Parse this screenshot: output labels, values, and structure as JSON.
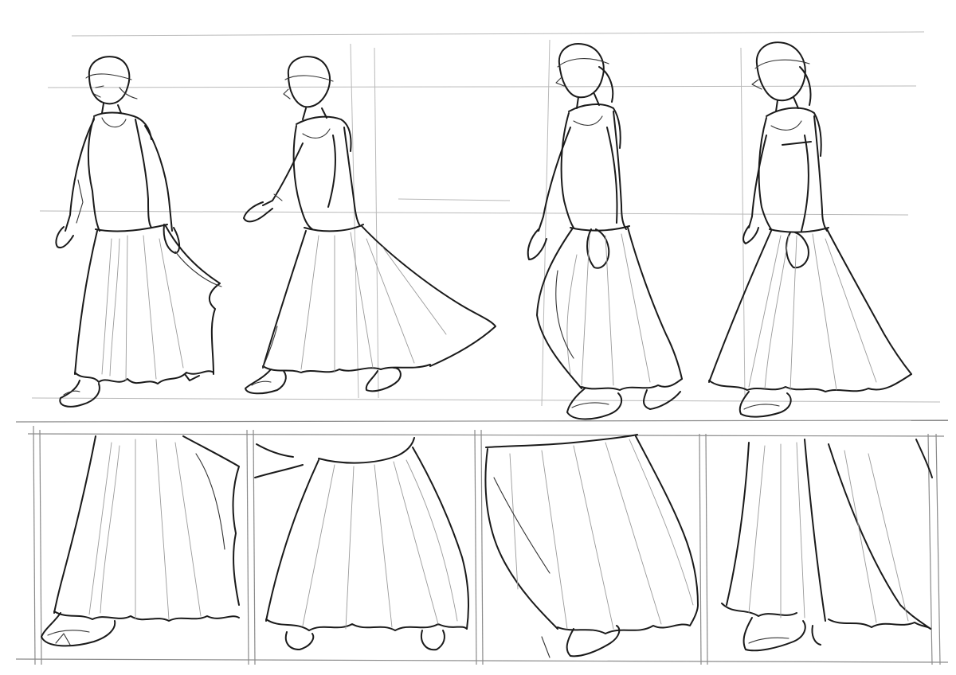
{
  "sheet": {
    "kind": "pencil-sketch-study",
    "palette": {
      "paper": "#ffffff",
      "ink": "#1a1a1a",
      "construction": "#b9b9b9"
    },
    "top_row": {
      "figures": [
        {
          "id": "walk-1",
          "facing": "left"
        },
        {
          "id": "walk-2",
          "facing": "left"
        },
        {
          "id": "walk-3",
          "facing": "left"
        },
        {
          "id": "walk-4",
          "facing": "left"
        }
      ]
    },
    "bottom_row": {
      "panels": [
        {
          "id": "skirt-detail-1"
        },
        {
          "id": "skirt-detail-2"
        },
        {
          "id": "skirt-detail-3"
        },
        {
          "id": "skirt-detail-4"
        }
      ]
    }
  }
}
